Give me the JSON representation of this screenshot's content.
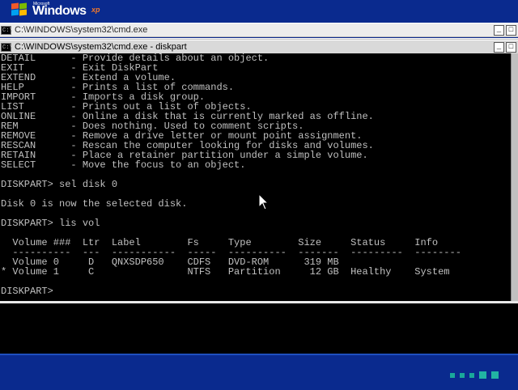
{
  "desktop": {
    "logo_small": "Microsoft",
    "logo_word": "Windows",
    "logo_sup": "xp"
  },
  "back_window": {
    "title": "C:\\WINDOWS\\system32\\cmd.exe",
    "icon_text": "C:\\"
  },
  "front_window": {
    "title": "C:\\WINDOWS\\system32\\cmd.exe - diskpart",
    "icon_text": "C:\\",
    "controls": [
      "_",
      "□"
    ]
  },
  "console": {
    "lines": [
      "DETAIL      - Provide details about an object.",
      "EXIT        - Exit DiskPart",
      "EXTEND      - Extend a volume.",
      "HELP        - Prints a list of commands.",
      "IMPORT      - Imports a disk group.",
      "LIST        - Prints out a list of objects.",
      "ONLINE      - Online a disk that is currently marked as offline.",
      "REM         - Does nothing. Used to comment scripts.",
      "REMOVE      - Remove a drive letter or mount point assignment.",
      "RESCAN      - Rescan the computer looking for disks and volumes.",
      "RETAIN      - Place a retainer partition under a simple volume.",
      "SELECT      - Move the focus to an object.",
      "",
      "DISKPART> sel disk 0",
      "",
      "Disk 0 is now the selected disk.",
      "",
      "DISKPART> lis vol",
      "",
      "  Volume ###  Ltr  Label        Fs     Type        Size     Status     Info",
      "  ----------  ---  -----------  -----  ----------  -------  ---------  --------",
      "  Volume 0     D   QNXSDP650    CDFS   DVD-ROM      319 MB",
      "* Volume 1     C                NTFS   Partition     12 GB  Healthy    System",
      "",
      "DISKPART>"
    ]
  }
}
